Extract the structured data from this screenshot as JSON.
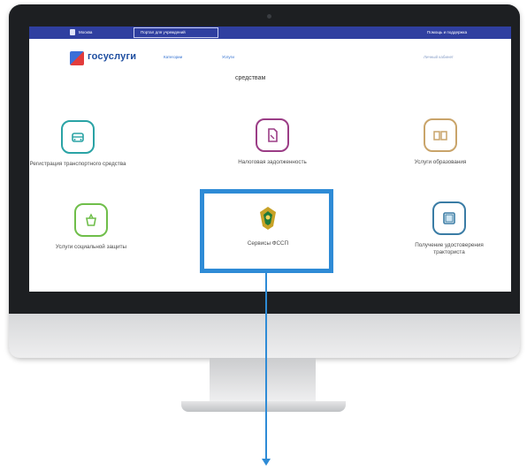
{
  "topbar": {
    "location": "Москва",
    "crumb": "Портал для учреждений",
    "right": "Помощь и поддержка"
  },
  "header": {
    "logo": "госуслуги",
    "nav": [
      "Категории",
      "Услуги"
    ],
    "login": "Личный кабинет"
  },
  "subtitle": "средствам",
  "tiles": [
    {
      "label": "Регистрация транспортного средства",
      "icon": "car-icon"
    },
    {
      "label": "Налоговая задолженность",
      "icon": "document-icon"
    },
    {
      "label": "Услуги образования",
      "icon": "book-icon"
    },
    {
      "label": "Услуги социальной защиты",
      "icon": "basket-icon"
    },
    {
      "label": "Сервисы ФССП",
      "icon": "fssp-emblem-icon"
    },
    {
      "label": "Получение удостоверения тракториста",
      "icon": "license-icon"
    }
  ],
  "colors": {
    "accent": "#2e8bd6",
    "teal": "#2aa3a5",
    "topbar": "#2f3fa0"
  }
}
